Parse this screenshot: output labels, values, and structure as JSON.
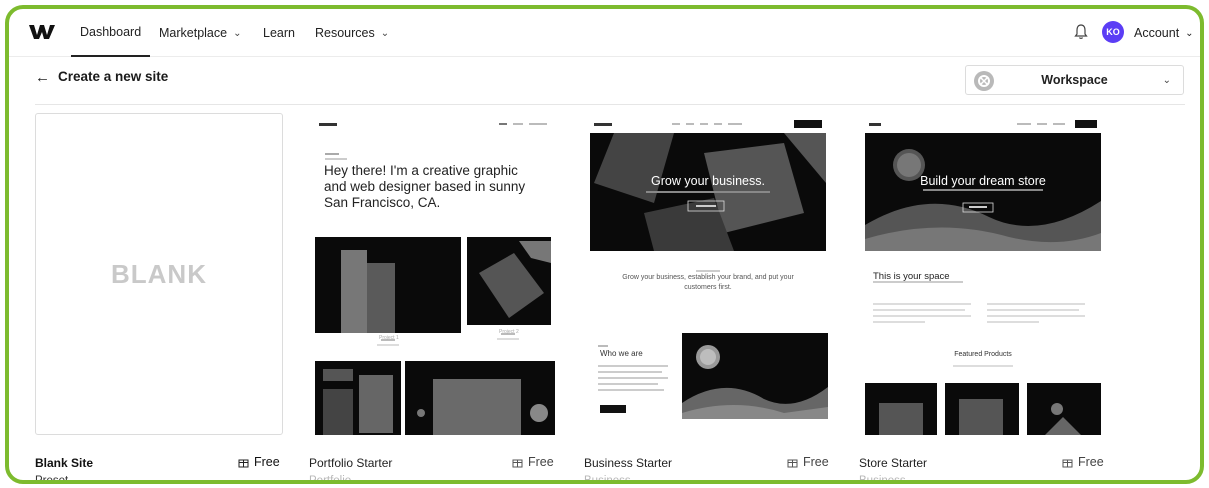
{
  "nav": {
    "items": [
      "Dashboard",
      "Marketplace",
      "Learn",
      "Resources"
    ],
    "account_initials": "KO",
    "account_label": "Account"
  },
  "header": {
    "back_icon": "arrow-left-icon",
    "title": "Create a new site",
    "workspace": "Workspace"
  },
  "colors": {
    "frame": "#7dbb2e",
    "avatar": "#5b3df5"
  },
  "templates": [
    {
      "title": "Blank Site",
      "subtitle": "Preset",
      "price": "Free",
      "preview_text": "BLANK"
    },
    {
      "title": "Portfolio Starter",
      "subtitle": "Portfolio",
      "price": "Free",
      "preview": {
        "headline": "Hey there! I'm a creative graphic and web designer based in sunny San Francisco, CA.",
        "caption1": "Project 1",
        "caption2": "Project 2"
      }
    },
    {
      "title": "Business Starter",
      "subtitle": "Business",
      "price": "Free",
      "preview": {
        "headline": "Grow your business.",
        "tagline": "Grow your business, establish your brand, and put your customers first.",
        "section": "Who we are"
      }
    },
    {
      "title": "Store Starter",
      "subtitle": "Business",
      "price": "Free",
      "preview": {
        "headline": "Build your dream store",
        "section": "This is your space",
        "featured": "Featured Products"
      }
    }
  ]
}
